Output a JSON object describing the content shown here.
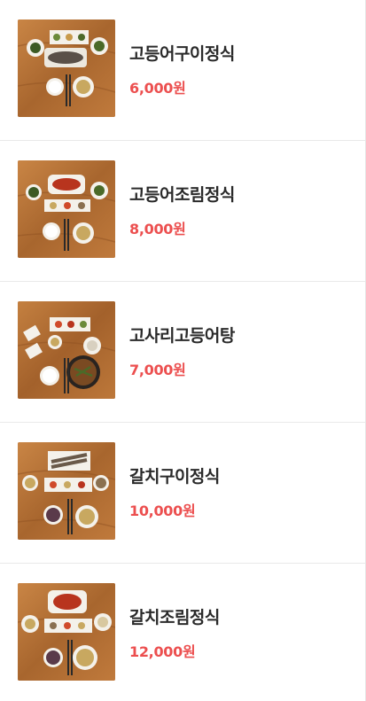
{
  "colors": {
    "price": "#ec4f4f",
    "name": "#2a2a2a",
    "divider": "#e9e9e9",
    "wood": "#b5733a"
  },
  "menu": {
    "items": [
      {
        "name": "고등어구이정식",
        "price": "6,000원",
        "image_icon": "food-photo-icon"
      },
      {
        "name": "고등어조림정식",
        "price": "8,000원",
        "image_icon": "food-photo-icon"
      },
      {
        "name": "고사리고등어탕",
        "price": "7,000원",
        "image_icon": "food-photo-icon"
      },
      {
        "name": "갈치구이정식",
        "price": "10,000원",
        "image_icon": "food-photo-icon"
      },
      {
        "name": "갈치조림정식",
        "price": "12,000원",
        "image_icon": "food-photo-icon"
      }
    ]
  }
}
